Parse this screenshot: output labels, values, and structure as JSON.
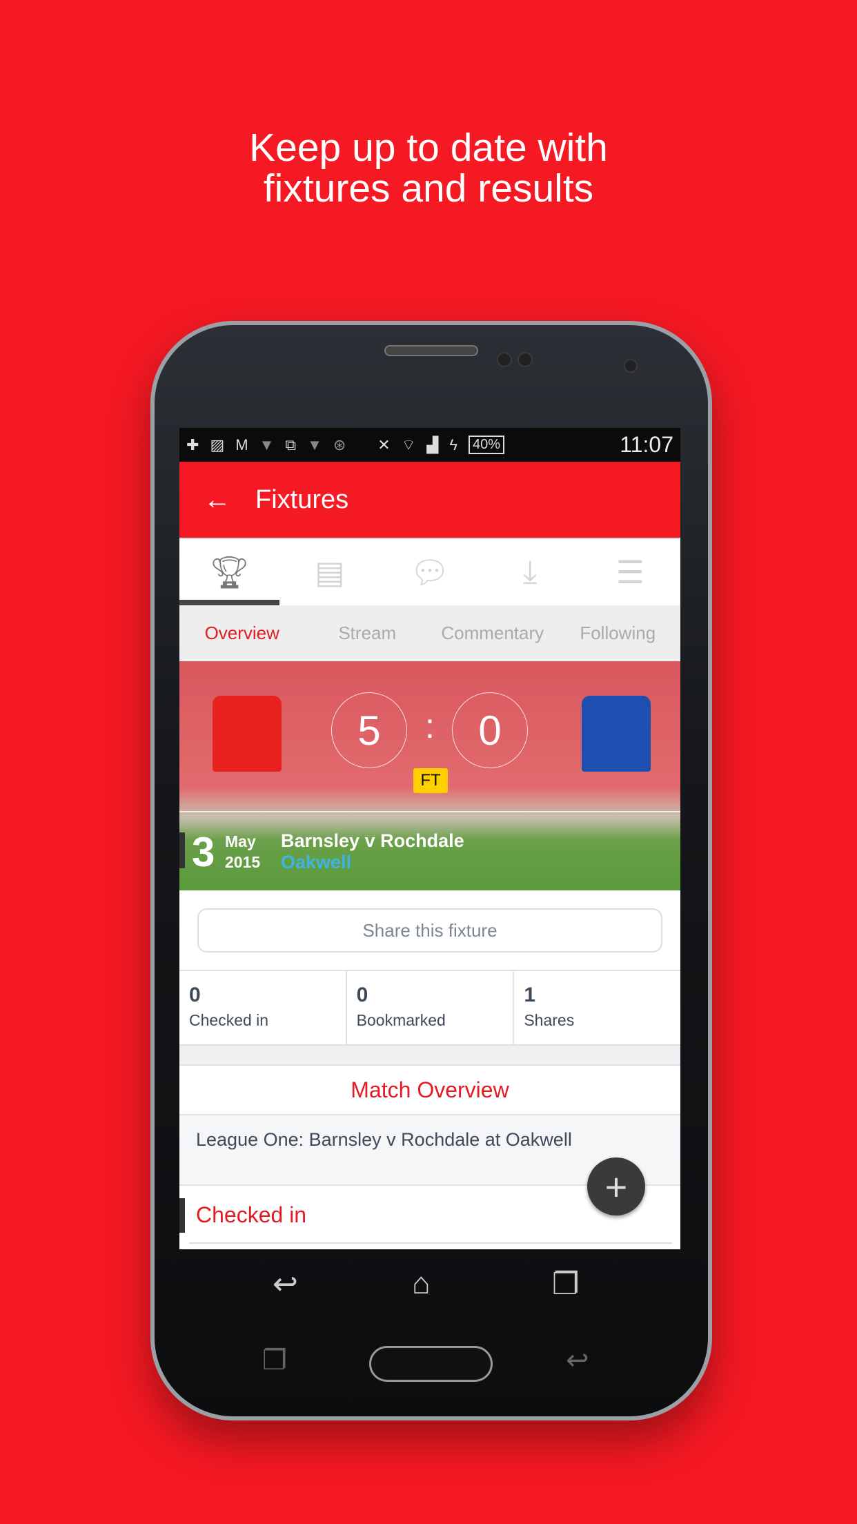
{
  "headline": {
    "line1": "Keep up to date with",
    "line2": "fixtures and results"
  },
  "status_bar": {
    "battery": "40%",
    "time": "11:07",
    "icons": [
      "app-plus-icon",
      "image-icon",
      "gmail-icon",
      "shirt-icon",
      "windows-icon",
      "shirt-icon",
      "wheel-icon",
      "bluetooth-off-icon",
      "wifi-icon",
      "signal-icon",
      "charging-icon"
    ]
  },
  "app_bar": {
    "title": "Fixtures",
    "back_icon": "arrow-left-icon",
    "color": "#f51923"
  },
  "icon_tabs": [
    {
      "icon": "trophy-icon",
      "active": true
    },
    {
      "icon": "news-icon"
    },
    {
      "icon": "chat-icon"
    },
    {
      "icon": "inbox-download-icon"
    },
    {
      "icon": "menu-icon"
    }
  ],
  "sub_tabs": [
    {
      "label": "Overview",
      "active": true
    },
    {
      "label": "Stream"
    },
    {
      "label": "Commentary"
    },
    {
      "label": "Following"
    }
  ],
  "fixture": {
    "home_score": "5",
    "separator": ":",
    "away_score": "0",
    "status": "FT",
    "day": "3",
    "month": "May",
    "year": "2015",
    "match": "Barnsley v Rochdale",
    "venue": "Oakwell",
    "home_kit_color": "#e8221f",
    "away_kit_color": "#1d4fb0"
  },
  "share_label": "Share this fixture",
  "stats": [
    {
      "value": "0",
      "label": "Checked in"
    },
    {
      "value": "0",
      "label": "Bookmarked"
    },
    {
      "value": "1",
      "label": "Shares"
    }
  ],
  "match_overview": {
    "title": "Match Overview",
    "text": "League One: Barnsley v Rochdale at Oakwell"
  },
  "checked_in_title": "Checked in",
  "fab_icon": "plus-icon"
}
